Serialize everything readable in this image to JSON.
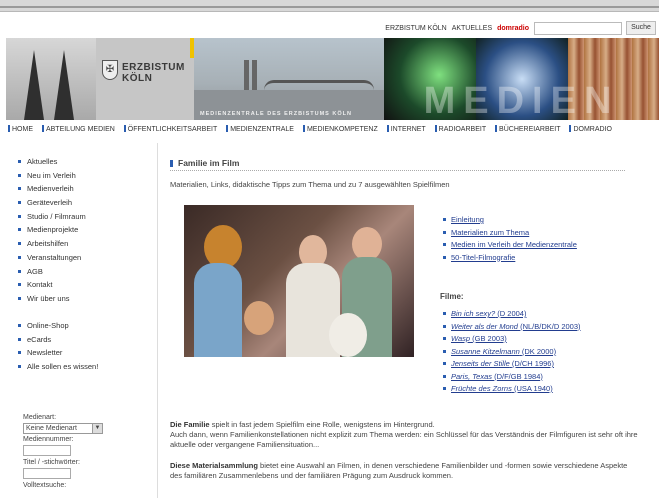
{
  "toplinks": {
    "site": "ERZBISTUM KÖLN",
    "aktuelles": "AKTUELLES",
    "domradio": "domradio"
  },
  "search": {
    "placeholder": "",
    "button": "Suche"
  },
  "banner": {
    "logo_line1": "ERZBISTUM",
    "logo_line2": "KÖLN",
    "caption": "MEDIENZENTRALE DES ERZBISTUMS KÖLN",
    "medien": "MEDIEN"
  },
  "nav": [
    "HOME",
    "ABTEILUNG MEDIEN",
    "ÖFFENTLICHKEITSARBEIT",
    "MEDIENZENTRALE",
    "MEDIENKOMPETENZ",
    "INTERNET",
    "RADIOARBEIT",
    "BÜCHEREIARBEIT",
    "DOMRADIO"
  ],
  "sidebar": {
    "items": [
      "Aktuelles",
      "Neu im Verleih",
      "Medienverleih",
      "Geräteverleih",
      "Studio / Filmraum",
      "Medienprojekte",
      "Arbeitshilfen",
      "Veranstaltungen",
      "AGB",
      "Kontakt",
      "Wir über uns"
    ],
    "items2": [
      "Online-Shop",
      "eCards",
      "Newsletter",
      "Alle sollen es wissen!"
    ],
    "form": {
      "medienart_label": "Medienart:",
      "medienart_value": "Keine Medienart",
      "mediennummer_label": "Mediennummer:",
      "titel_label": "Titel / -stichwörter:",
      "volltext_label": "Volltextsuche:"
    }
  },
  "main": {
    "title": "Familie im Film",
    "intro": "Materialien, Links, didaktische Tipps zum Thema und zu 7 ausgewählten Spielfilmen",
    "links": [
      "Einleitung",
      "Materialien zum Thema",
      "Medien im Verleih der Medienzentrale",
      "50-Titel-Filmografie"
    ],
    "filme_title": "Filme:",
    "films": [
      {
        "title": "Bin ich sexy?",
        "info": "(D 2004)"
      },
      {
        "title": "Weiter als der Mond",
        "info": "(NL/B/DK/D 2003)"
      },
      {
        "title": "Wasp",
        "info": "(GB 2003)"
      },
      {
        "title": "Susanne Kitzelmann",
        "info": "(DK 2000)"
      },
      {
        "title": "Jenseits der Stille",
        "info": "(D/CH 1996)"
      },
      {
        "title": "Paris, Texas",
        "info": "(D/F/GB 1984)"
      },
      {
        "title": "Früchte des Zorns",
        "info": "(USA 1940)"
      }
    ],
    "para1_bold": "Die Familie",
    "para1_rest": " spielt in fast jedem Spielfilm eine Rolle, wenigstens im Hintergrund.",
    "para1_line2": "Auch dann, wenn Familienkonstellationen nicht explizit zum Thema werden: ein Schlüssel für das Verständnis der Filmfiguren ist sehr oft ihre aktuelle oder vergangene Familiensituation...",
    "para2_bold": "Diese Materialsammlung",
    "para2_rest": " bietet eine Auswahl an Filmen, in denen verschiedene Familienbilder und -formen sowie verschiedene Aspekte des familiären Zusammenlebens und der familiären Prägung zum Ausdruck kommen."
  }
}
